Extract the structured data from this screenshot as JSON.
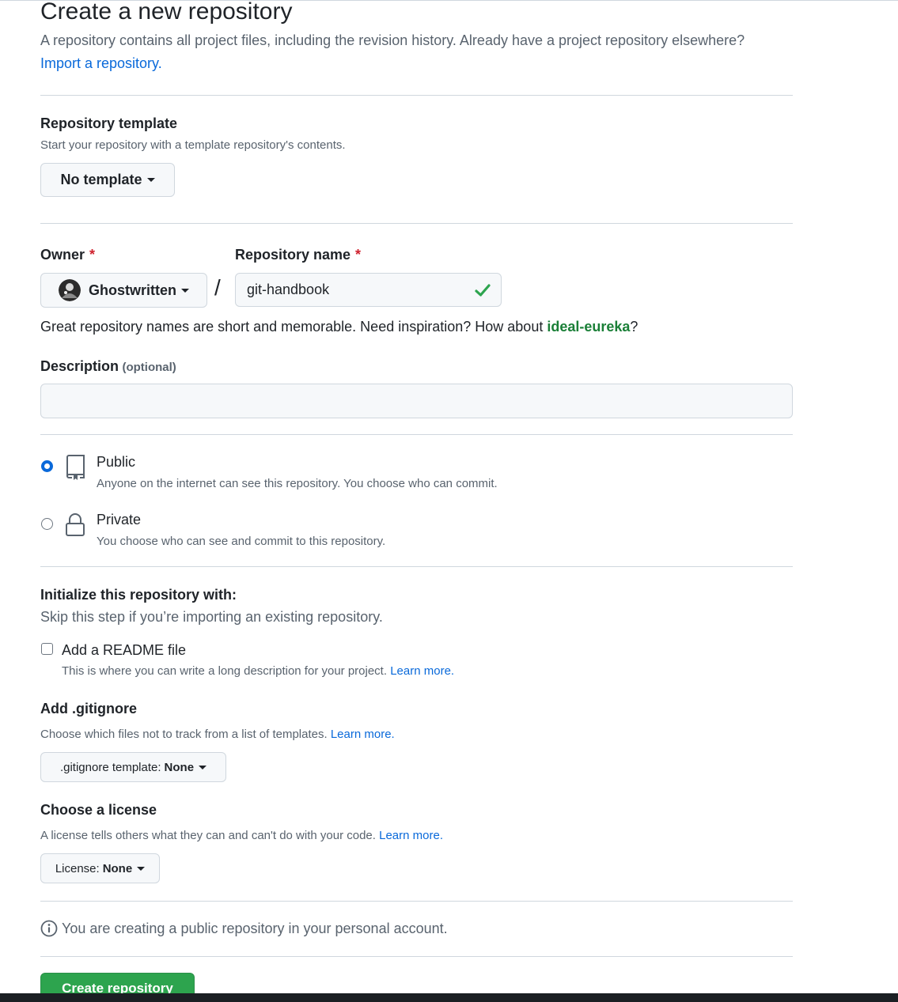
{
  "header": {
    "title": "Create a new repository",
    "subtitle": "A repository contains all project files, including the revision history. Already have a project repository elsewhere?",
    "import_link": "Import a repository."
  },
  "template": {
    "label": "Repository template",
    "note": "Start your repository with a template repository's contents.",
    "button_label": "No template"
  },
  "owner": {
    "label": "Owner",
    "required_mark": "*",
    "value": "Ghostwritten",
    "avatar_icon": "avatar-icon"
  },
  "separator": "/",
  "repo_name": {
    "label": "Repository name",
    "required_mark": "*",
    "value": "git-handbook",
    "valid_icon": "check-icon"
  },
  "suggestion": {
    "text": "Great repository names are short and memorable. Need inspiration? How about ",
    "name": "ideal-eureka",
    "suffix": "?"
  },
  "description": {
    "label": "Description",
    "optional": "(optional)",
    "value": ""
  },
  "visibility": {
    "public": {
      "title": "Public",
      "note": "Anyone on the internet can see this repository. You choose who can commit.",
      "selected": true,
      "icon": "repo-icon"
    },
    "private": {
      "title": "Private",
      "note": "You choose who can see and commit to this repository.",
      "selected": false,
      "icon": "lock-icon"
    }
  },
  "initialize": {
    "title": "Initialize this repository with:",
    "note": "Skip this step if you’re importing an existing repository.",
    "readme": {
      "label": "Add a README file",
      "note": "This is where you can write a long description for your project.",
      "link": "Learn more.",
      "checked": false
    }
  },
  "gitignore": {
    "title": "Add .gitignore",
    "note": "Choose which files not to track from a list of templates.",
    "link": "Learn more.",
    "button_prefix": ".gitignore template:",
    "button_value": "None"
  },
  "license": {
    "title": "Choose a license",
    "note": "A license tells others what they can and can't do with your code.",
    "link": "Learn more.",
    "button_prefix": "License:",
    "button_value": "None"
  },
  "info": {
    "icon": "info-icon",
    "text": "You are creating a public repository in your personal account."
  },
  "submit": {
    "label": "Create repository"
  },
  "colors": {
    "accent": "#0969da",
    "success": "#2da44e",
    "suggestion": "#1a7f37",
    "required": "#cf222e"
  }
}
